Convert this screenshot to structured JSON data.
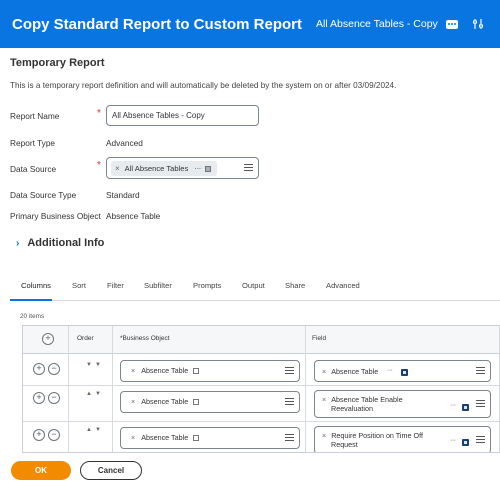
{
  "header": {
    "title": "Copy Standard Report to Custom Report",
    "subtitle": "All Absence Tables - Copy",
    "related_actions_icon": "more-icon",
    "config_icon": "sliders-icon"
  },
  "section_title": "Temporary Report",
  "notice": "This is a temporary report definition and will automatically be deleted by the system on or after 03/09/2024.",
  "form": {
    "report_name_label": "Report Name",
    "report_name_value": "All Absence Tables - Copy",
    "report_type_label": "Report Type",
    "report_type_value": "Advanced",
    "data_source_label": "Data Source",
    "data_source_value": "All Absence Tables",
    "data_source_type_label": "Data Source Type",
    "data_source_type_value": "Standard",
    "primary_bo_label": "Primary Business Object",
    "primary_bo_value": "Absence Table",
    "required_mark": "*"
  },
  "additional_info": {
    "label": "Additional Info",
    "icon": "chevron-right-icon"
  },
  "tabs": [
    "Columns",
    "Sort",
    "Filter",
    "Subfilter",
    "Prompts",
    "Output",
    "Share",
    "Advanced"
  ],
  "active_tab": "Columns",
  "items_count": "20 items",
  "grid": {
    "headers": {
      "order": "Order",
      "business_object": "*Business Object",
      "field": "Field"
    },
    "rows": [
      {
        "business_object": "Absence Table",
        "field_line1": "Absence Table",
        "field_line2": ""
      },
      {
        "business_object": "Absence Table",
        "field_line1": "Absence Table Enable",
        "field_line2": "Reevaluation"
      },
      {
        "business_object": "Absence Table",
        "field_line1": "Require Position on Time Off",
        "field_line2": "Request"
      }
    ]
  },
  "buttons": {
    "ok": "OK",
    "cancel": "Cancel"
  },
  "colors": {
    "header_blue": "#0875e1",
    "ok_orange": "#f38b00",
    "required_red": "#de2e21"
  }
}
